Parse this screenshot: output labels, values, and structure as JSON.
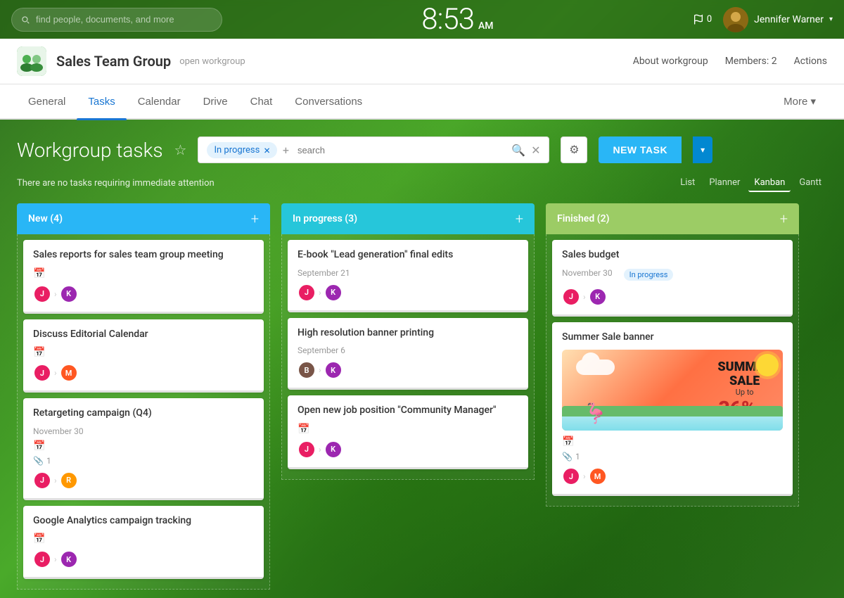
{
  "topbar": {
    "search_placeholder": "find people, documents, and more",
    "clock": "8:53",
    "clock_suffix": "AM",
    "flag_count": "0",
    "user_name": "Jennifer Warner"
  },
  "workgroup": {
    "title": "Sales Team Group",
    "subtitle": "open workgroup",
    "about_btn": "About workgroup",
    "members_btn": "Members: 2",
    "actions_btn": "Actions"
  },
  "nav": {
    "tabs": [
      "General",
      "Tasks",
      "Calendar",
      "Drive",
      "Chat",
      "Conversations"
    ],
    "active_tab": "Tasks",
    "more_label": "More ▾"
  },
  "tasks_view": {
    "title": "Workgroup tasks",
    "filter_chip": "In progress",
    "search_placeholder": "search",
    "status_text": "There are no tasks requiring immediate attention",
    "new_task_label": "NEW TASK",
    "views": [
      "List",
      "Planner",
      "Kanban",
      "Gantt"
    ],
    "active_view": "Kanban"
  },
  "columns": [
    {
      "title": "New",
      "count": 4,
      "type": "new",
      "cards": [
        {
          "title": "Sales reports for sales team group meeting",
          "date": "",
          "has_calendar": true,
          "avatars": [
            "#E91E63",
            "#9C27B0"
          ],
          "avatar_initials": [
            "J",
            "K"
          ]
        },
        {
          "title": "Discuss Editorial Calendar",
          "date": "",
          "has_calendar": true,
          "avatars": [
            "#E91E63",
            "#FF5722"
          ],
          "avatar_initials": [
            "J",
            "M"
          ]
        },
        {
          "title": "Retargeting campaign (Q4)",
          "date": "November 30",
          "has_calendar": true,
          "attach_count": "1",
          "avatars": [
            "#E91E63",
            "#FF9800"
          ],
          "avatar_initials": [
            "J",
            "R"
          ]
        },
        {
          "title": "Google Analytics campaign tracking",
          "date": "",
          "has_calendar": true,
          "avatars": [
            "#E91E63",
            "#9C27B0"
          ],
          "avatar_initials": [
            "J",
            "K"
          ]
        }
      ]
    },
    {
      "title": "In progress",
      "count": 3,
      "type": "progress",
      "cards": [
        {
          "title": "E-book \"Lead generation\" final edits",
          "date": "September 21",
          "avatars": [
            "#E91E63",
            "#9C27B0"
          ],
          "avatar_initials": [
            "J",
            "K"
          ]
        },
        {
          "title": "High resolution banner printing",
          "date": "September 6",
          "avatars": [
            "#795548",
            "#9C27B0"
          ],
          "avatar_initials": [
            "B",
            "K"
          ]
        },
        {
          "title": "Open new job position \"Community Manager\"",
          "date": "",
          "has_calendar": true,
          "avatars": [
            "#E91E63",
            "#9C27B0"
          ],
          "avatar_initials": [
            "J",
            "K"
          ]
        }
      ]
    },
    {
      "title": "Finished",
      "count": 2,
      "type": "finished",
      "cards": [
        {
          "title": "Sales budget",
          "date": "November 30",
          "status_badge": "In progress",
          "avatars": [
            "#E91E63",
            "#9C27B0"
          ],
          "avatar_initials": [
            "J",
            "K"
          ]
        },
        {
          "title": "Summer Sale banner",
          "date": "",
          "has_summer_banner": true,
          "has_calendar": true,
          "attach_count": "1",
          "avatars": [
            "#E91E63",
            "#FF5722"
          ],
          "avatar_initials": [
            "J",
            "M"
          ]
        }
      ]
    }
  ]
}
